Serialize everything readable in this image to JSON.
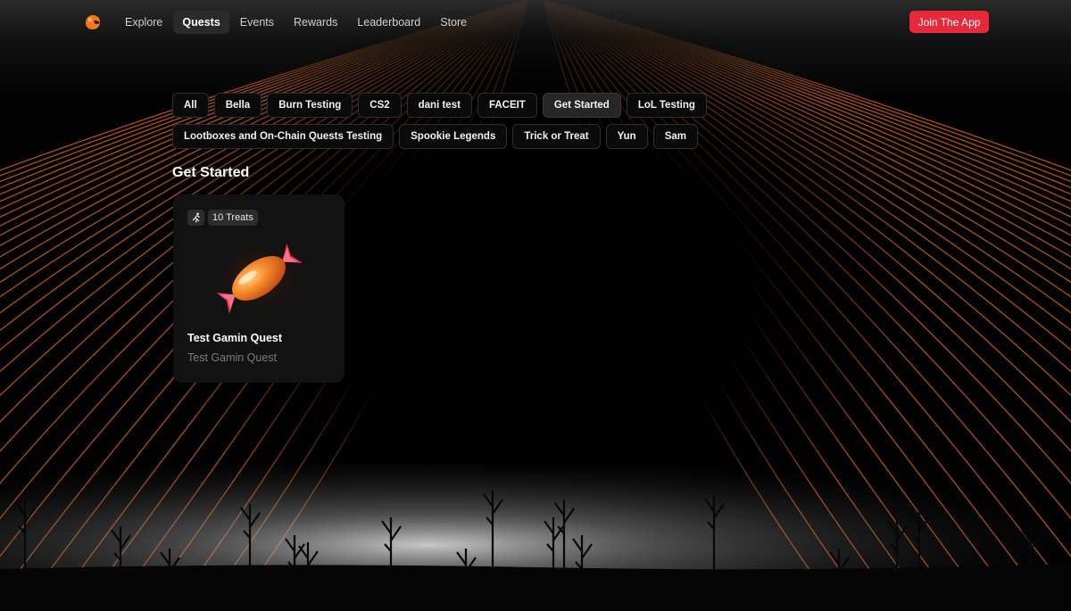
{
  "nav": {
    "logo_icon": "orange-blob-logo-icon",
    "links": [
      {
        "label": "Explore",
        "active": false
      },
      {
        "label": "Quests",
        "active": true
      },
      {
        "label": "Events",
        "active": false
      },
      {
        "label": "Rewards",
        "active": false
      },
      {
        "label": "Leaderboard",
        "active": false
      },
      {
        "label": "Store",
        "active": false
      }
    ],
    "join_label": "Join The App"
  },
  "filters": [
    {
      "label": "All",
      "active": false
    },
    {
      "label": "Bella",
      "active": false
    },
    {
      "label": "Burn Testing",
      "active": false
    },
    {
      "label": "CS2",
      "active": false
    },
    {
      "label": "dani test",
      "active": false
    },
    {
      "label": "FACEIT",
      "active": false
    },
    {
      "label": "Get Started",
      "active": true
    },
    {
      "label": "LoL Testing",
      "active": false
    },
    {
      "label": "Lootboxes and On-Chain Quests Testing",
      "active": false
    },
    {
      "label": "Spookie Legends",
      "active": false
    },
    {
      "label": "Trick or Treat",
      "active": false
    },
    {
      "label": "Yun",
      "active": false
    },
    {
      "label": "Sam",
      "active": false
    }
  ],
  "section_title": "Get Started",
  "quest_card": {
    "type_icon": "runner-icon",
    "reward_label": "10 Treats",
    "image_icon": "candy-icon",
    "title": "Test Gamin Quest",
    "subtitle": "Test Gamin Quest"
  },
  "colors": {
    "accent": "#e8283b",
    "background": "#000000",
    "card": "#121212",
    "chip_border": "#2f2f2f",
    "line_orange": "#d8661e",
    "logo_orange": "#f07a1c"
  }
}
